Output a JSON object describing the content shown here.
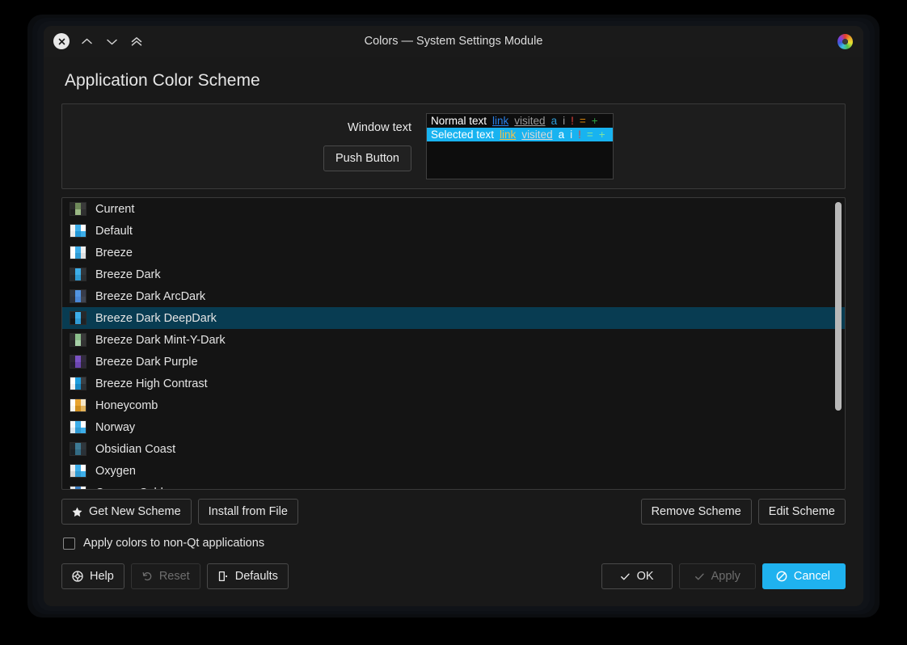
{
  "window": {
    "titlebar": {
      "title": "Colors — System Settings Module",
      "close_label": "Close",
      "up_label": "Previous",
      "down_label": "Next",
      "collapse_label": "Collapse",
      "app_icon": "color-wheel-icon"
    }
  },
  "page": {
    "title": "Application Color Scheme"
  },
  "preview": {
    "window_text_label": "Window text",
    "push_button_label": "Push Button",
    "lines": [
      {
        "kind": "normal",
        "text": "Normal text",
        "link": "link",
        "visited": "visited",
        "a": "a",
        "i": "i",
        "bang": "!",
        "eq": "=",
        "plus": "+"
      },
      {
        "kind": "selected",
        "text": "Selected text",
        "link": "link",
        "visited": "visited",
        "a": "a",
        "i": "i",
        "bang": "!",
        "eq": "=",
        "plus": "+"
      }
    ]
  },
  "scheme_list": {
    "selected_index": 5,
    "items": [
      {
        "label": "Current",
        "swatch": [
          "#2a2a2a",
          "#6f8a5a",
          "#3a3a3a",
          "#1e1e1e",
          "#9ab884",
          "#303030"
        ]
      },
      {
        "label": "Default",
        "swatch": [
          "#f2f2f2",
          "#3daee9",
          "#ffffff",
          "#e8e8e8",
          "#2196d6",
          "#3daee9"
        ]
      },
      {
        "label": "Breeze",
        "swatch": [
          "#ffffff",
          "#3daee9",
          "#eff0f1",
          "#fcfcfc",
          "#2f9bd4",
          "#dfe0e1"
        ]
      },
      {
        "label": "Breeze Dark",
        "swatch": [
          "#2a2e32",
          "#3daee9",
          "#31363b",
          "#232629",
          "#2f9bd4",
          "#2a2e32"
        ]
      },
      {
        "label": "Breeze Dark ArcDark",
        "swatch": [
          "#2f343f",
          "#5294e2",
          "#383c4a",
          "#2b2f3a",
          "#4a87d6",
          "#404552"
        ]
      },
      {
        "label": "Breeze Dark DeepDark",
        "swatch": [
          "#1b1f22",
          "#3daee9",
          "#26292c",
          "#141618",
          "#2f9bd4",
          "#1f2225"
        ]
      },
      {
        "label": "Breeze Dark Mint-Y-Dark",
        "swatch": [
          "#2f2f2f",
          "#8bbf8b",
          "#3a3a3a",
          "#252525",
          "#a6cfa6",
          "#333333"
        ]
      },
      {
        "label": "Breeze Dark Purple",
        "swatch": [
          "#2b2535",
          "#7b52c4",
          "#332b40",
          "#221d2b",
          "#6b45b0",
          "#2e2738"
        ]
      },
      {
        "label": "Breeze High Contrast",
        "swatch": [
          "#ffffff",
          "#1f9ede",
          "#3a3f44",
          "#f0f0f0",
          "#1888c4",
          "#2b3035"
        ]
      },
      {
        "label": "Honeycomb",
        "swatch": [
          "#ffffff",
          "#e8a430",
          "#f5e6c8",
          "#fbf6ea",
          "#d08f1e",
          "#e3b45c"
        ]
      },
      {
        "label": "Norway",
        "swatch": [
          "#f7f7f7",
          "#3daee9",
          "#ffffff",
          "#dbe7ef",
          "#2f9bd4",
          "#3daee9"
        ]
      },
      {
        "label": "Obsidian Coast",
        "swatch": [
          "#22272b",
          "#3d7a94",
          "#2f373d",
          "#1b2024",
          "#336b84",
          "#2a3238"
        ]
      },
      {
        "label": "Oxygen",
        "swatch": [
          "#eeeeee",
          "#3daee9",
          "#ffffff",
          "#d6d6d6",
          "#2f9bd4",
          "#3daee9"
        ]
      },
      {
        "label": "Oxygen Cold",
        "swatch": [
          "#e9e9e9",
          "#3b7fc4",
          "#fdfdfd",
          "#d2d2d2",
          "#2f6db0",
          "#4a90d9"
        ]
      }
    ]
  },
  "scheme_actions": {
    "get_new_scheme": "Get New Scheme",
    "install_from_file": "Install from File",
    "remove_scheme": "Remove Scheme",
    "edit_scheme": "Edit Scheme"
  },
  "options": {
    "apply_non_qt_label": "Apply colors to non-Qt applications",
    "apply_non_qt_checked": false
  },
  "footer": {
    "help": "Help",
    "reset": "Reset",
    "defaults": "Defaults",
    "ok": "OK",
    "apply": "Apply",
    "cancel": "Cancel",
    "reset_enabled": false,
    "apply_enabled": false
  },
  "colors": {
    "accent": "#1fb2ef",
    "selection_row": "#083c52",
    "preview_selection": "#18b3f0",
    "link": "#2980e8",
    "visited": "#9b9b9b",
    "negative": "#e2403a",
    "neutral": "#d4820a",
    "positive": "#2ea043",
    "window_bg": "#191919"
  }
}
